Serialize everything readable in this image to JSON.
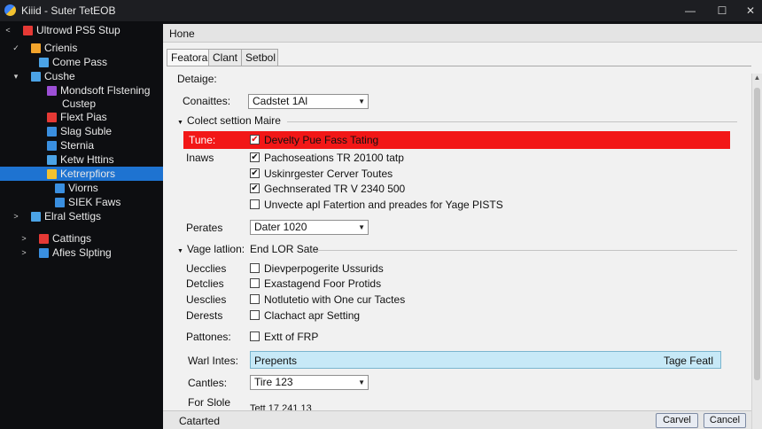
{
  "window": {
    "title": "Kiiid - Suter TetEOB",
    "controls": {
      "minimize": "—",
      "maximize": "☐",
      "close": "✕"
    }
  },
  "sidebar": {
    "items": [
      {
        "label": "Ultrowd PS5 Stup",
        "twisty": "<",
        "icon_color": "#e53935"
      },
      {
        "label": "Crienis",
        "twisty": "✓",
        "icon_color": "#f2a42c"
      },
      {
        "label": "Come Pass",
        "twisty": "",
        "icon_color": "#4ba3e6"
      },
      {
        "label": "Cushe",
        "twisty": "▾",
        "icon_color": "#4ba3e6"
      },
      {
        "label": "Mondsoft Flstening",
        "twisty": "",
        "icon_color": "#9c4fd6"
      },
      {
        "label": "Custep",
        "twisty": "",
        "icon_color": ""
      },
      {
        "label": "Flext Pias",
        "twisty": "",
        "icon_color": "#e53935"
      },
      {
        "label": "Slag Suble",
        "twisty": "",
        "icon_color": "#3a8fe0"
      },
      {
        "label": "Sternia",
        "twisty": "",
        "icon_color": "#3a8fe0"
      },
      {
        "label": "Ketw Httins",
        "twisty": "",
        "icon_color": "#4ba3e6"
      },
      {
        "label": "Ketrerpfiors",
        "twisty": "",
        "icon_color": "#f2c230"
      },
      {
        "label": "Viorns",
        "twisty": "",
        "icon_color": "#3a8fe0"
      },
      {
        "label": "SIEK Faws",
        "twisty": "",
        "icon_color": "#3a8fe0"
      },
      {
        "label": "Elral Settigs",
        "twisty": ">",
        "icon_color": "#4ba3e6"
      },
      {
        "label": "Cattings",
        "twisty": ">",
        "icon_color": "#e53935"
      },
      {
        "label": "Afies Slpting",
        "twisty": ">",
        "icon_color": "#3a8fe0"
      }
    ],
    "selected_item": "Ketrerpfiors"
  },
  "panel": {
    "header": "Hone",
    "tabs": [
      "Featora",
      "Clant",
      "Setbol"
    ],
    "active_tab": "Featora",
    "group_title": "Detaige:",
    "conattes": {
      "label": "Conaittes:",
      "value": "Cadstet 1Al"
    },
    "section1": "Colect settion Maire",
    "tune_label": "Tune:",
    "highlight_checkbox": {
      "text": "Develty Pue Fass Tating",
      "checked": true
    },
    "inaws_label": "Inaws",
    "checkboxes1": [
      {
        "text": "Pachoseations TR 20100 tatp",
        "checked": true
      },
      {
        "text": "Uskinrgester Cerver Toutes",
        "checked": true
      },
      {
        "text": "Gechnserated TR V 2340 500",
        "checked": true
      },
      {
        "text": "Unvecte apl Fatertion and preades for Yage PISTS",
        "checked": false
      }
    ],
    "perates": {
      "label": "Perates",
      "value": "Dater 1020"
    },
    "section2": "Vage latlion:",
    "section2_value": "End LOR Sate",
    "checkboxes2": [
      {
        "label": "Uecclies",
        "text": "Dievperpogerite Ussurids",
        "checked": false
      },
      {
        "label": "Detclies",
        "text": "Exastagend Foor Protids",
        "checked": false
      },
      {
        "label": "Uesclies",
        "text": "Notlutetio with One cur Tactes",
        "checked": false
      },
      {
        "label": "Derests",
        "text": "Clachact apr Setting",
        "checked": false
      }
    ],
    "pattones": {
      "label": "Pattones:",
      "text": "Extt of FRP",
      "checked": false
    },
    "warl_intes": {
      "label": "Warl Intes:",
      "value": "Prepents",
      "right_text": "Tage Featl"
    },
    "cantles": {
      "label": "Cantles:",
      "value": "Tire 123"
    },
    "for_slole": {
      "label": "For Slole",
      "value": "Tett 17 241 13"
    },
    "footer": {
      "status": "Catarted",
      "buttons": [
        "Carvel",
        "Cancel"
      ]
    },
    "check_glyph": "✔",
    "arrow_glyph": "▼"
  }
}
